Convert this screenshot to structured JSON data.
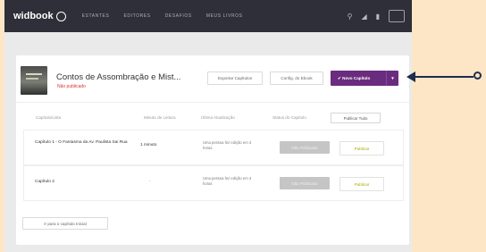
{
  "brand": {
    "name": "widbook"
  },
  "nav": [
    "ESTANTES",
    "EDITORES",
    "DESAFIOS",
    "MEUS LIVROS"
  ],
  "book": {
    "title": "Contos de Assombração e Mist...",
    "status": "Não publicado"
  },
  "actions": {
    "export": "Exportar Capítulos",
    "config": "Config. do Ebook",
    "new_chapter": "✔  Novo Capítulo"
  },
  "table": {
    "headers": [
      "Capítulo/Lista",
      "Minuto de Leitura",
      "Última Atualização",
      "Status do Capítulo"
    ],
    "tab_label": "Publicar Tudo",
    "rows": [
      {
        "title": "Capítulo 1 - O Fantasma da Av. Paulista Sai Rua",
        "read_time": "1 minuto",
        "updated": "Uma pessoa fez edição em 3 horas",
        "status": "Não Publicado",
        "action": "Publicar"
      },
      {
        "title": "Capítulo 2",
        "read_time": "-",
        "updated": "Uma pessoa fez edição em 3 horas",
        "status": "Não Publicado",
        "action": "Publicar"
      }
    ]
  },
  "bottom": {
    "button": "Ir para o capítulo Inicial"
  },
  "colors": {
    "accent": "#6a2c7e",
    "topbar": "#2e2f38",
    "backdrop": "#fde6c6",
    "arrow": "#1e2d4d"
  }
}
